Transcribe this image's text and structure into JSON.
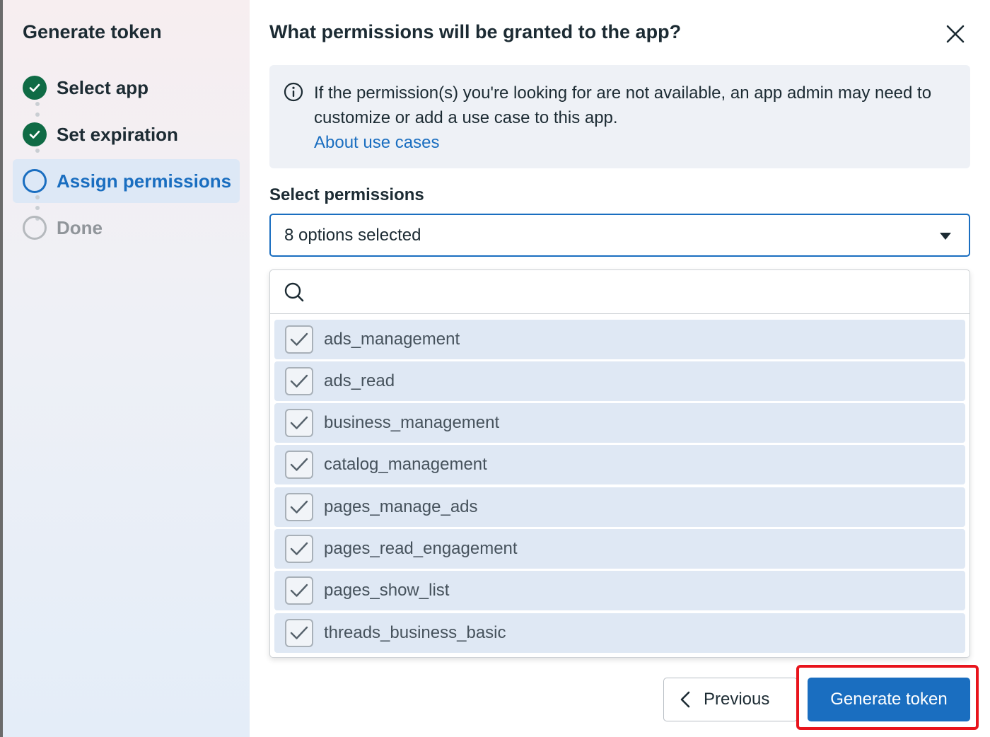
{
  "colors": {
    "accent": "#1a6ec0",
    "done_green": "#0f6b45",
    "option_bg": "#dfe8f4",
    "highlight_red": "#e8141c"
  },
  "sidebar": {
    "title": "Generate token",
    "steps": [
      {
        "label": "Select app",
        "state": "done",
        "icon": "check-circle-icon"
      },
      {
        "label": "Set expiration",
        "state": "done",
        "icon": "check-circle-icon"
      },
      {
        "label": "Assign permissions",
        "state": "current",
        "icon": "empty-circle-icon"
      },
      {
        "label": "Done",
        "state": "pending",
        "icon": "empty-circle-icon"
      }
    ]
  },
  "dialog": {
    "title": "What permissions will be granted to the app?",
    "close_icon": "close-icon",
    "info": {
      "icon": "info-icon",
      "text": "If the permission(s) you're looking for are not available, an app admin may need to customize or add a use case to this app.",
      "link": "About use cases"
    },
    "select": {
      "label": "Select permissions",
      "value": "8 options selected",
      "caret_icon": "caret-down-icon"
    },
    "dropdown": {
      "search_icon": "search-icon",
      "search_value": "",
      "options": [
        {
          "label": "ads_management",
          "checked": true
        },
        {
          "label": "ads_read",
          "checked": true
        },
        {
          "label": "business_management",
          "checked": true
        },
        {
          "label": "catalog_management",
          "checked": true
        },
        {
          "label": "pages_manage_ads",
          "checked": true
        },
        {
          "label": "pages_read_engagement",
          "checked": true
        },
        {
          "label": "pages_show_list",
          "checked": true
        },
        {
          "label": "threads_business_basic",
          "checked": true
        }
      ]
    },
    "footer": {
      "previous_label": "Previous",
      "generate_label": "Generate token"
    }
  }
}
